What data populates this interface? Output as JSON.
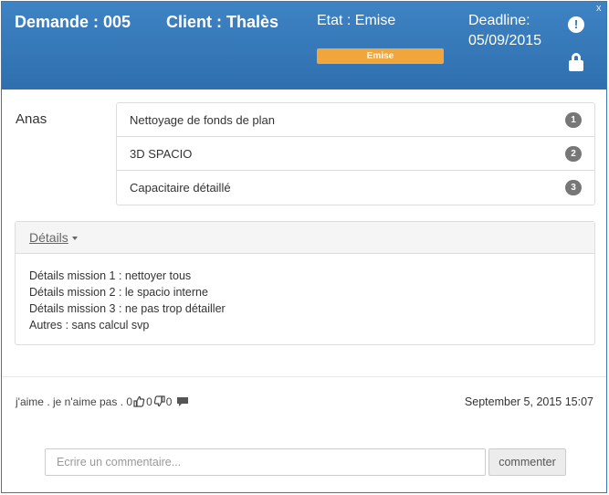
{
  "header": {
    "demande": "Demande : 005",
    "client": "Client : Thalès",
    "etat": "Etat : Emise",
    "status_badge": "Emise",
    "deadline_label": "Deadline:",
    "deadline_value": "05/09/2015",
    "close_glyph": "x",
    "alert_glyph": "!",
    "icons": [
      "close-icon",
      "exclamation-circle-icon",
      "lock-icon"
    ],
    "colors": {
      "header_bg": "#3478b8",
      "badge": "#f0a63a"
    }
  },
  "user": "Anas",
  "tasks": [
    {
      "label": "Nettoyage de fonds de plan",
      "badge": "1"
    },
    {
      "label": "3D SPACIO",
      "badge": "2"
    },
    {
      "label": "Capacitaire détaillé",
      "badge": "3"
    }
  ],
  "details": {
    "toggle_label": "Détails",
    "lines": [
      "Détails mission 1 : nettoyer tous",
      "Détails mission 2 : le spacio interne",
      "Détails mission 3 : ne pas trop détailler",
      "Autres : sans calcul svp"
    ]
  },
  "social": {
    "like_label": "j'aime",
    "separator": ".",
    "dislike_label": "je n'aime pas",
    "count_a": "0",
    "like_count": "0",
    "dislike_count": "0",
    "icons": [
      "thumbs-up-icon",
      "thumbs-down-icon",
      "comment-icon"
    ]
  },
  "timestamp": "September 5, 2015 15:07",
  "comment": {
    "placeholder": "Ecrire un commentaire...",
    "button_label": "commenter"
  }
}
